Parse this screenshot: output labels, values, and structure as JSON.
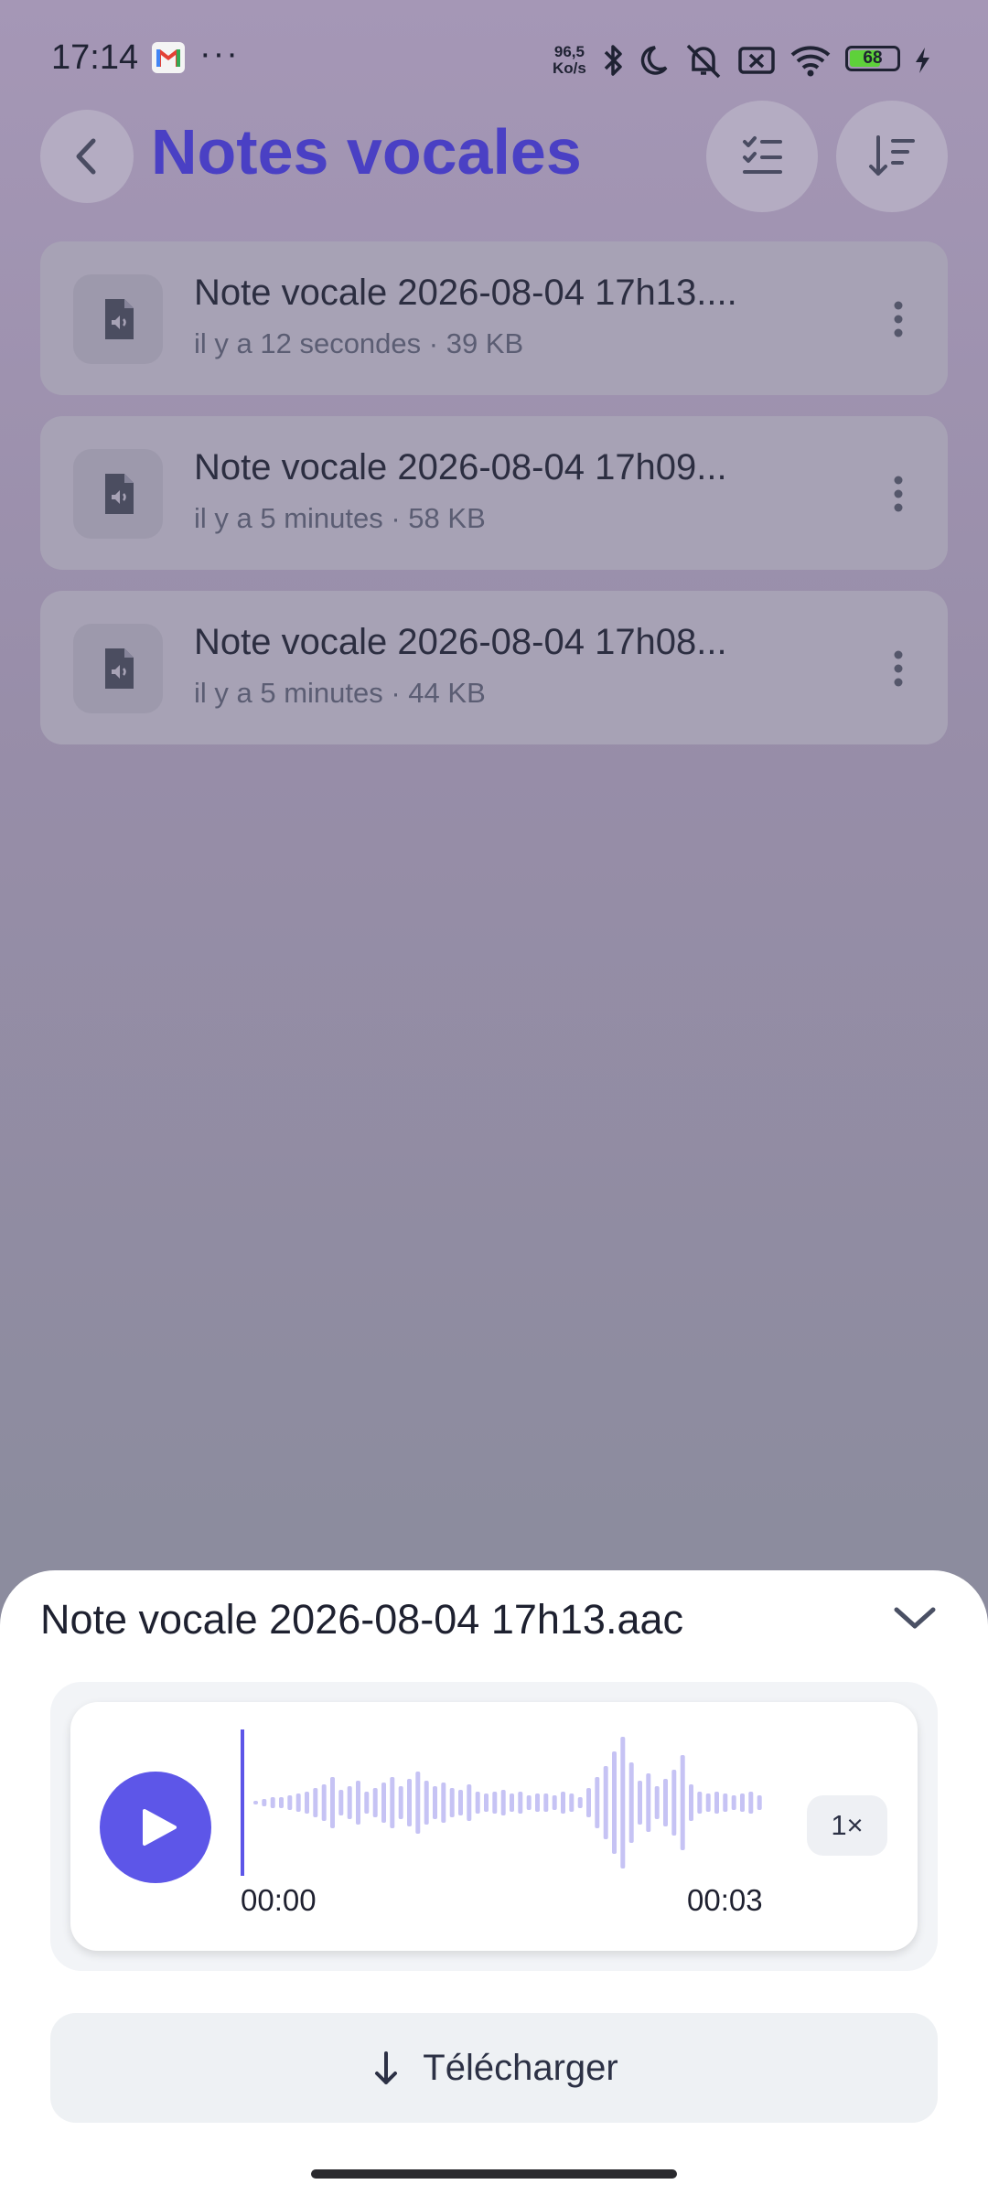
{
  "status_bar": {
    "time": "17:14",
    "net_speed_value": "96,5",
    "net_speed_unit": "Ko/s",
    "battery": "68"
  },
  "header": {
    "title": "Notes vocales"
  },
  "notes": [
    {
      "title": "Note vocale 2026-08-04 17h13....",
      "subtitle": "il y a 12 secondes · 39 KB"
    },
    {
      "title": "Note vocale 2026-08-04 17h09...",
      "subtitle": "il y a 5 minutes · 58 KB"
    },
    {
      "title": "Note vocale 2026-08-04 17h08...",
      "subtitle": "il y a 5 minutes · 44 KB"
    }
  ],
  "player": {
    "file_name": "Note vocale 2026-08-04 17h13.aac",
    "current_time": "00:00",
    "duration": "00:03",
    "speed": "1×",
    "progress": 0
  },
  "download": {
    "label": "Télécharger"
  },
  "colors": {
    "accent": "#5d56e8",
    "title": "#4a40c4",
    "waveform": "#c6c3f4"
  }
}
